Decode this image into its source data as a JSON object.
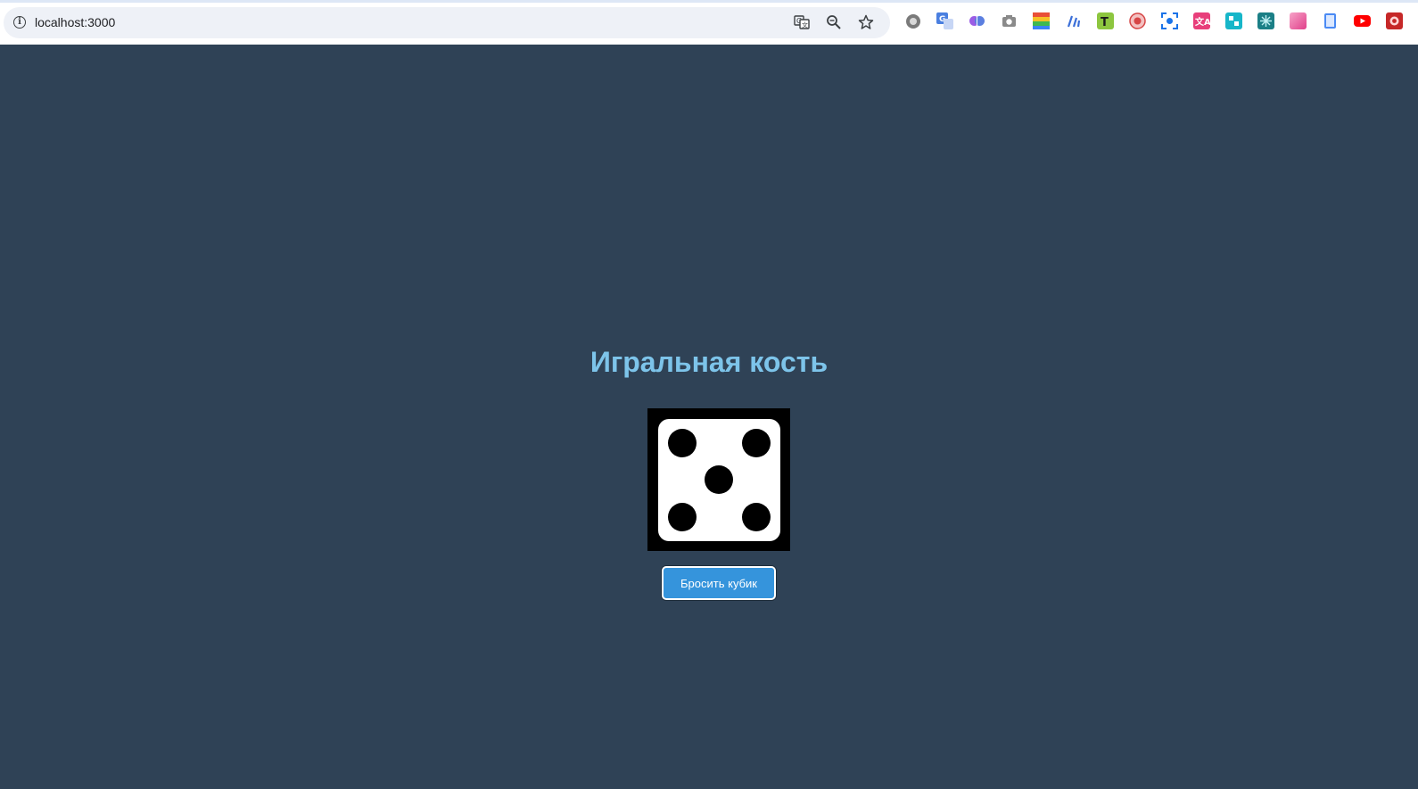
{
  "browser": {
    "url": "localhost:3000",
    "omnibox_actions": [
      "translate-icon",
      "zoom-icon",
      "bookmark-star-icon"
    ],
    "extensions": [
      {
        "name": "extension-gray-circle-icon",
        "color": "#7a7a7a"
      },
      {
        "name": "extension-translate-icon",
        "color": "#4a7fe0"
      },
      {
        "name": "extension-brain-icon",
        "color": "#9b5de5"
      },
      {
        "name": "extension-camera-icon",
        "color": "#8a8a8a"
      },
      {
        "name": "extension-colorgrid-icon",
        "color": "#e94f37"
      },
      {
        "name": "extension-chart-icon",
        "color": "#3b6fd8"
      },
      {
        "name": "extension-green-t-icon",
        "color": "#8dc63f"
      },
      {
        "name": "extension-red-circle-icon",
        "color": "#d64545"
      },
      {
        "name": "extension-screenshot-icon",
        "color": "#1a73e8"
      },
      {
        "name": "extension-pink-icon",
        "color": "#e83e7a"
      },
      {
        "name": "extension-cyan-icon",
        "color": "#17b6c9"
      },
      {
        "name": "extension-teal-icon",
        "color": "#1b7f86"
      },
      {
        "name": "extension-gradient-icon",
        "color": "#f06fa8"
      },
      {
        "name": "extension-doc-icon",
        "color": "#4a8af4"
      },
      {
        "name": "extension-youtube-icon",
        "color": "#ff0000"
      },
      {
        "name": "extension-red-square-icon",
        "color": "#c62828"
      }
    ]
  },
  "page": {
    "title": "Игральная кость",
    "die_value": 5,
    "roll_button_label": "Бросить кубик",
    "colors": {
      "background": "#2f4256",
      "title": "#7dc4ea",
      "button": "#3594dc"
    }
  }
}
